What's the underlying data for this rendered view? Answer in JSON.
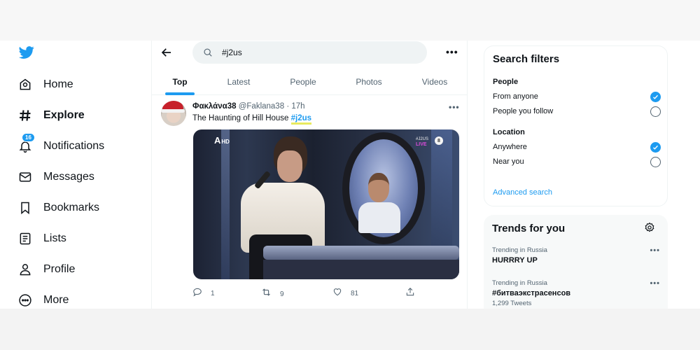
{
  "sidebar": {
    "logo": "twitter-bird",
    "items": [
      {
        "label": "Home",
        "icon": "home-icon"
      },
      {
        "label": "Explore",
        "icon": "hashtag-icon",
        "active": true
      },
      {
        "label": "Notifications",
        "icon": "bell-icon",
        "badge": "16"
      },
      {
        "label": "Messages",
        "icon": "envelope-icon"
      },
      {
        "label": "Bookmarks",
        "icon": "bookmark-icon"
      },
      {
        "label": "Lists",
        "icon": "list-icon"
      },
      {
        "label": "Profile",
        "icon": "person-icon"
      },
      {
        "label": "More",
        "icon": "more-circle-icon"
      }
    ]
  },
  "search": {
    "value": "#j2us",
    "more_label": "•••"
  },
  "tabs": [
    {
      "label": "Top",
      "active": true
    },
    {
      "label": "Latest"
    },
    {
      "label": "People"
    },
    {
      "label": "Photos"
    },
    {
      "label": "Videos"
    }
  ],
  "tweet": {
    "name": "Φακλάνα38",
    "handle": "@Faklana38",
    "separator": "·",
    "time": "17h",
    "text": "The Haunting of Hill House ",
    "hashtag": "#j2us",
    "more_label": "•••",
    "media": {
      "channel_logo": "A",
      "channel_hd": "HD",
      "overlay_tag": "#J2US",
      "overlay_live": "LIVE",
      "rating": "8"
    },
    "actions": {
      "replies": "1",
      "retweets": "9",
      "likes": "81"
    }
  },
  "filters": {
    "title": "Search filters",
    "people": {
      "heading": "People",
      "options": [
        {
          "label": "From anyone",
          "selected": true
        },
        {
          "label": "People you follow",
          "selected": false
        }
      ]
    },
    "location": {
      "heading": "Location",
      "options": [
        {
          "label": "Anywhere",
          "selected": true
        },
        {
          "label": "Near you",
          "selected": false
        }
      ]
    },
    "advanced_link": "Advanced search"
  },
  "trends": {
    "title": "Trends for you",
    "items": [
      {
        "context": "Trending in Russia",
        "name": "HURRRY UP",
        "count": ""
      },
      {
        "context": "Trending in Russia",
        "name": "#битваэкстрасенсов",
        "count": "1,299 Tweets"
      }
    ],
    "more_label": "•••"
  },
  "colors": {
    "accent": "#1d9bf0",
    "text": "#0f1419",
    "secondary": "#536471"
  }
}
